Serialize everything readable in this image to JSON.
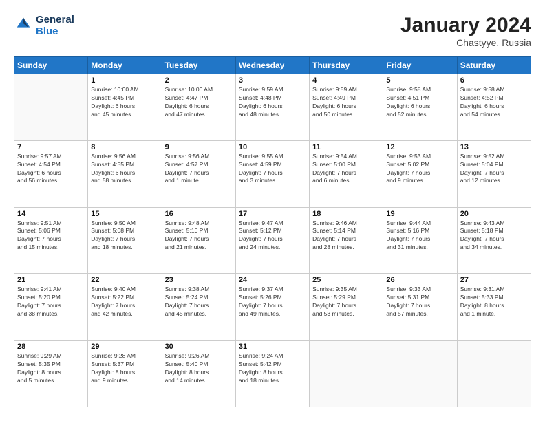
{
  "logo": {
    "line1": "General",
    "line2": "Blue"
  },
  "calendar": {
    "title": "January 2024",
    "subtitle": "Chastyye, Russia",
    "days_header": [
      "Sunday",
      "Monday",
      "Tuesday",
      "Wednesday",
      "Thursday",
      "Friday",
      "Saturday"
    ],
    "weeks": [
      [
        {
          "day": "",
          "info": ""
        },
        {
          "day": "1",
          "info": "Sunrise: 10:00 AM\nSunset: 4:45 PM\nDaylight: 6 hours\nand 45 minutes."
        },
        {
          "day": "2",
          "info": "Sunrise: 10:00 AM\nSunset: 4:47 PM\nDaylight: 6 hours\nand 47 minutes."
        },
        {
          "day": "3",
          "info": "Sunrise: 9:59 AM\nSunset: 4:48 PM\nDaylight: 6 hours\nand 48 minutes."
        },
        {
          "day": "4",
          "info": "Sunrise: 9:59 AM\nSunset: 4:49 PM\nDaylight: 6 hours\nand 50 minutes."
        },
        {
          "day": "5",
          "info": "Sunrise: 9:58 AM\nSunset: 4:51 PM\nDaylight: 6 hours\nand 52 minutes."
        },
        {
          "day": "6",
          "info": "Sunrise: 9:58 AM\nSunset: 4:52 PM\nDaylight: 6 hours\nand 54 minutes."
        }
      ],
      [
        {
          "day": "7",
          "info": "Sunrise: 9:57 AM\nSunset: 4:54 PM\nDaylight: 6 hours\nand 56 minutes."
        },
        {
          "day": "8",
          "info": "Sunrise: 9:56 AM\nSunset: 4:55 PM\nDaylight: 6 hours\nand 58 minutes."
        },
        {
          "day": "9",
          "info": "Sunrise: 9:56 AM\nSunset: 4:57 PM\nDaylight: 7 hours\nand 1 minute."
        },
        {
          "day": "10",
          "info": "Sunrise: 9:55 AM\nSunset: 4:59 PM\nDaylight: 7 hours\nand 3 minutes."
        },
        {
          "day": "11",
          "info": "Sunrise: 9:54 AM\nSunset: 5:00 PM\nDaylight: 7 hours\nand 6 minutes."
        },
        {
          "day": "12",
          "info": "Sunrise: 9:53 AM\nSunset: 5:02 PM\nDaylight: 7 hours\nand 9 minutes."
        },
        {
          "day": "13",
          "info": "Sunrise: 9:52 AM\nSunset: 5:04 PM\nDaylight: 7 hours\nand 12 minutes."
        }
      ],
      [
        {
          "day": "14",
          "info": "Sunrise: 9:51 AM\nSunset: 5:06 PM\nDaylight: 7 hours\nand 15 minutes."
        },
        {
          "day": "15",
          "info": "Sunrise: 9:50 AM\nSunset: 5:08 PM\nDaylight: 7 hours\nand 18 minutes."
        },
        {
          "day": "16",
          "info": "Sunrise: 9:48 AM\nSunset: 5:10 PM\nDaylight: 7 hours\nand 21 minutes."
        },
        {
          "day": "17",
          "info": "Sunrise: 9:47 AM\nSunset: 5:12 PM\nDaylight: 7 hours\nand 24 minutes."
        },
        {
          "day": "18",
          "info": "Sunrise: 9:46 AM\nSunset: 5:14 PM\nDaylight: 7 hours\nand 28 minutes."
        },
        {
          "day": "19",
          "info": "Sunrise: 9:44 AM\nSunset: 5:16 PM\nDaylight: 7 hours\nand 31 minutes."
        },
        {
          "day": "20",
          "info": "Sunrise: 9:43 AM\nSunset: 5:18 PM\nDaylight: 7 hours\nand 34 minutes."
        }
      ],
      [
        {
          "day": "21",
          "info": "Sunrise: 9:41 AM\nSunset: 5:20 PM\nDaylight: 7 hours\nand 38 minutes."
        },
        {
          "day": "22",
          "info": "Sunrise: 9:40 AM\nSunset: 5:22 PM\nDaylight: 7 hours\nand 42 minutes."
        },
        {
          "day": "23",
          "info": "Sunrise: 9:38 AM\nSunset: 5:24 PM\nDaylight: 7 hours\nand 45 minutes."
        },
        {
          "day": "24",
          "info": "Sunrise: 9:37 AM\nSunset: 5:26 PM\nDaylight: 7 hours\nand 49 minutes."
        },
        {
          "day": "25",
          "info": "Sunrise: 9:35 AM\nSunset: 5:29 PM\nDaylight: 7 hours\nand 53 minutes."
        },
        {
          "day": "26",
          "info": "Sunrise: 9:33 AM\nSunset: 5:31 PM\nDaylight: 7 hours\nand 57 minutes."
        },
        {
          "day": "27",
          "info": "Sunrise: 9:31 AM\nSunset: 5:33 PM\nDaylight: 8 hours\nand 1 minute."
        }
      ],
      [
        {
          "day": "28",
          "info": "Sunrise: 9:29 AM\nSunset: 5:35 PM\nDaylight: 8 hours\nand 5 minutes."
        },
        {
          "day": "29",
          "info": "Sunrise: 9:28 AM\nSunset: 5:37 PM\nDaylight: 8 hours\nand 9 minutes."
        },
        {
          "day": "30",
          "info": "Sunrise: 9:26 AM\nSunset: 5:40 PM\nDaylight: 8 hours\nand 14 minutes."
        },
        {
          "day": "31",
          "info": "Sunrise: 9:24 AM\nSunset: 5:42 PM\nDaylight: 8 hours\nand 18 minutes."
        },
        {
          "day": "",
          "info": ""
        },
        {
          "day": "",
          "info": ""
        },
        {
          "day": "",
          "info": ""
        }
      ]
    ]
  }
}
